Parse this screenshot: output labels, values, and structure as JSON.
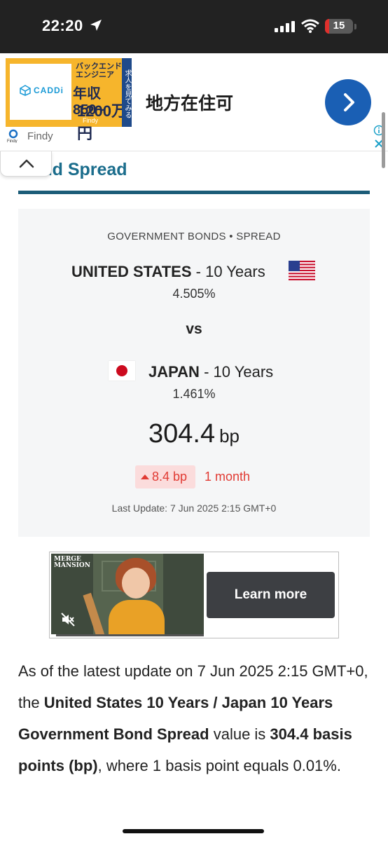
{
  "status_bar": {
    "time": "22:20",
    "battery": "15",
    "battery_level": 0.15,
    "background_color": "#222222",
    "battery_low_color": "#e0302c"
  },
  "ad_banner": {
    "image_logo": "CADDi",
    "image_title": "バックエンド\nエンジニア",
    "image_salary_a": "年収850~",
    "image_salary_b": "1200万円",
    "image_brand": "Findy",
    "image_side_cta": "求人を見てみる",
    "headline": "地方在住可",
    "advertiser": "Findy",
    "accent_color": "#1a5fb4",
    "image_color": "#f6b52c"
  },
  "section": {
    "title": "Bond Spread",
    "title_color": "#1b6d8c",
    "rule_color": "#1b5c78"
  },
  "spread_card": {
    "caption": "GOVERNMENT BONDS • SPREAD",
    "country_a": "UNITED STATES",
    "country_a_term": " - 10 Years",
    "country_a_yield": "4.505%",
    "vs": "vs",
    "country_b": "JAPAN",
    "country_b_term": " - 10 Years",
    "country_b_yield": "1.461%",
    "spread_value": "304.4",
    "spread_unit": "bp",
    "change_value": "8.4 bp",
    "change_direction": "up",
    "change_period": "1 month",
    "last_update": "Last Update: 7 Jun 2025 2:15 GMT+0",
    "change_color": "#e13b34",
    "change_bg_color": "#fbdcdc",
    "icons": [
      "us-flag-icon",
      "japan-flag-icon",
      "triangle-up-icon"
    ]
  },
  "video_ad": {
    "thumb_brand": "MERGE\nMANSION",
    "cta_label": "Learn more",
    "progress": 0.03,
    "icons": [
      "muted-speaker-icon"
    ]
  },
  "paragraph": {
    "part1": "As of the latest update on 7 Jun 2025 2:15 GMT+0, the ",
    "bold1": "United States 10 Years / Japan 10 Years Government Bond Spread",
    "part2": " value is ",
    "bold2": "304.4 basis points (bp)",
    "part3": ", where 1 basis point equals 0.01%."
  }
}
